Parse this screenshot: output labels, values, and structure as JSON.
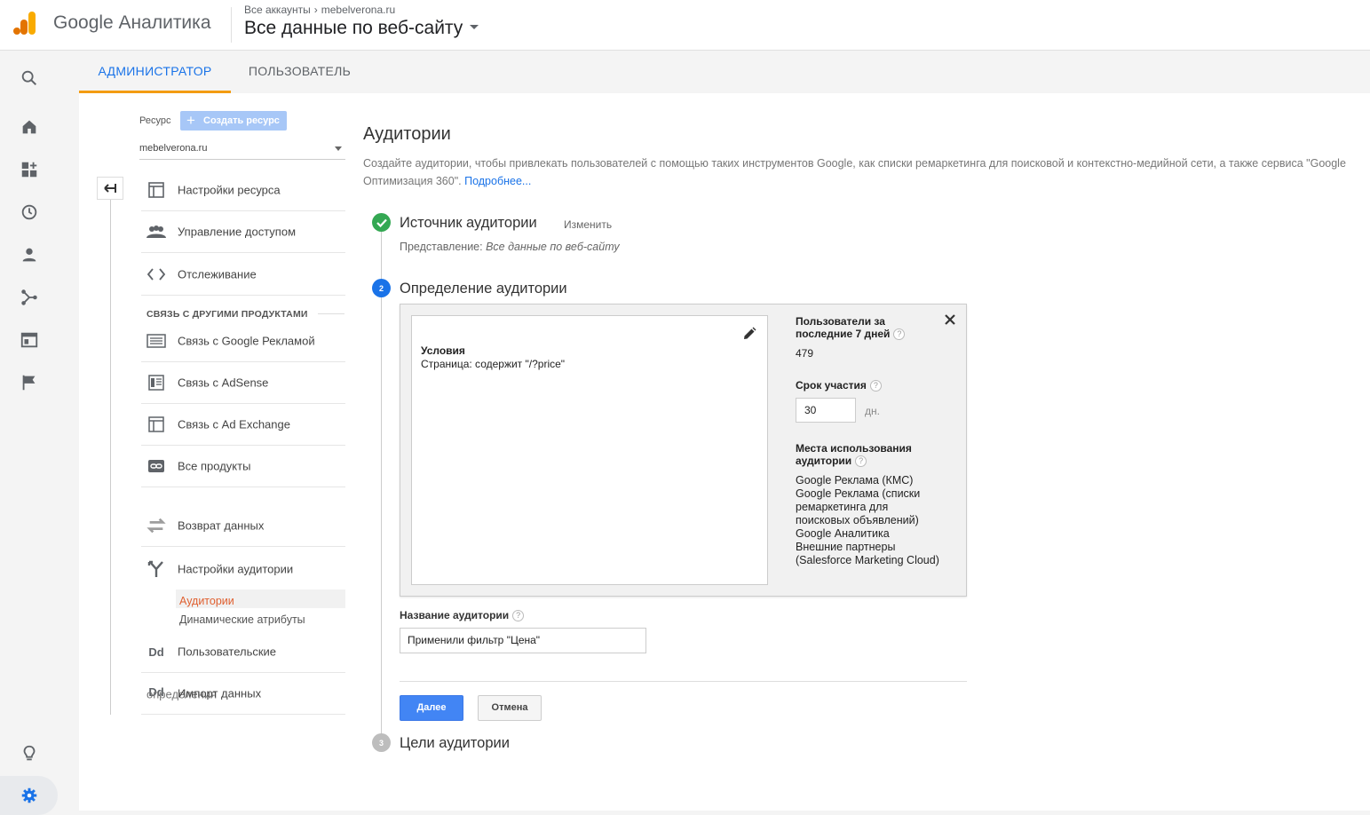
{
  "header": {
    "brand": "Google Аналитика",
    "breadcrumb_root": "Все аккаунты",
    "breadcrumb_account": "mebelverona.ru",
    "view_title": "Все данные по веб-сайту"
  },
  "tabs": [
    {
      "label": "АДМИНИСТРАТОР",
      "active": true
    },
    {
      "label": "ПОЛЬЗОВАТЕЛЬ",
      "active": false
    }
  ],
  "left_nav": [
    "search-icon",
    "home-icon",
    "customization-icon",
    "realtime-icon",
    "audience-icon",
    "acquisition-icon",
    "behavior-icon",
    "conversions-icon",
    "lightbulb-icon",
    "gear-icon"
  ],
  "admin": {
    "resource_label": "Ресурс",
    "create_resource": "Создать ресурс",
    "property": "mebelverona.ru",
    "items": [
      {
        "label": "Настройки ресурса"
      },
      {
        "label": "Управление доступом"
      },
      {
        "label": "Отслеживание"
      }
    ],
    "section_title": "СВЯЗЬ С ДРУГИМИ ПРОДУКТАМИ",
    "links": [
      {
        "label": "Связь с Google Рекламой"
      },
      {
        "label": "Связь с AdSense"
      },
      {
        "label": "Связь с Ad Exchange"
      },
      {
        "label": "Все продукты"
      }
    ],
    "more": [
      {
        "label": "Возврат данных"
      },
      {
        "label": "Настройки аудитории"
      }
    ],
    "sub_items": [
      "Аудитории",
      "Динамические атрибуты"
    ],
    "dd_icon": "Dd",
    "custom_defs": "Пользовательские",
    "import_overlap": "определения",
    "import": "Импорт данных"
  },
  "content": {
    "title": "Аудитории",
    "description": "Создайте аудитории, чтобы привлекать пользователей с помощью таких инструментов Google, как списки ремаркетинга для поисковой и контекстно-медийной сети, а также сервиса \"Google Оптимизация 360\".",
    "more_link": "Подробнее...",
    "step1": {
      "title": "Источник аудитории",
      "change": "Изменить",
      "view_label": "Представление:",
      "view_value": "Все данные по веб-сайту"
    },
    "step2": {
      "number": "2",
      "title": "Определение аудитории"
    },
    "conditions_title": "Условия",
    "conditions_value": "Страница: содержит \"/?price\"",
    "users_title": "Пользователи за последние 7 дней",
    "users_value": "479",
    "duration_title": "Срок участия",
    "duration_value": "30",
    "duration_unit": "дн.",
    "destinations_title": "Места использования аудитории",
    "destinations": [
      "Google Реклама (КМС)",
      "Google Реклама (списки",
      "ремаркетинга для",
      "поисковых объявлений)",
      "Google Аналитика",
      "Внешние партнеры",
      "(Salesforce Marketing Cloud)"
    ],
    "name_label": "Название аудитории",
    "name_value": "Применили фильтр \"Цена\"",
    "next_btn": "Далее",
    "cancel_btn": "Отмена",
    "step3": {
      "number": "3",
      "title": "Цели аудитории"
    }
  },
  "colors": {
    "accent": "#1a73e8",
    "tab_underline": "#f39c12",
    "step_done": "#34a853",
    "step_active": "#1a73e8",
    "step_pending": "#bdbdbd",
    "primary_btn": "#4285f4",
    "active_sub": "#e06030"
  }
}
